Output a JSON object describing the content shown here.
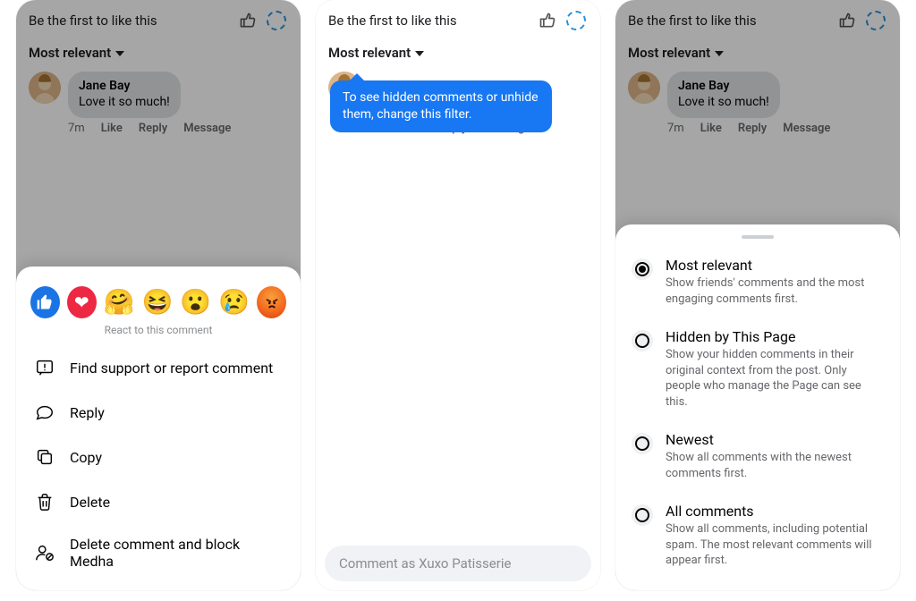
{
  "likePrompt": "Be the first to like this",
  "filterLabel": "Most relevant",
  "comment": {
    "name": "Jane Bay",
    "text": "Love it so much!",
    "time": "7m",
    "like": "Like",
    "reply": "Reply",
    "message": "Message"
  },
  "screen1": {
    "reactCaption": "React to this comment",
    "reactions": [
      "like",
      "love",
      "care",
      "haha",
      "wow",
      "sad",
      "angry"
    ],
    "options": [
      "Find support or report comment",
      "Reply",
      "Copy",
      "Delete",
      "Delete comment and block Medha"
    ]
  },
  "screen2": {
    "tooltip": "To see hidden comments or unhide them, change this filter.",
    "composerPlaceholder": "Comment as Xuxo Patisserie"
  },
  "screen3": {
    "filters": [
      {
        "title": "Most relevant",
        "desc": "Show friends' comments and the most engaging comments first.",
        "selected": true
      },
      {
        "title": "Hidden by This Page",
        "desc": "Show your hidden comments in their original context from the post. Only people who manage the Page can see this.",
        "selected": false
      },
      {
        "title": "Newest",
        "desc": "Show all comments with the newest comments first.",
        "selected": false
      },
      {
        "title": "All comments",
        "desc": "Show all comments, including potential spam. The most relevant comments will appear first.",
        "selected": false
      }
    ]
  }
}
